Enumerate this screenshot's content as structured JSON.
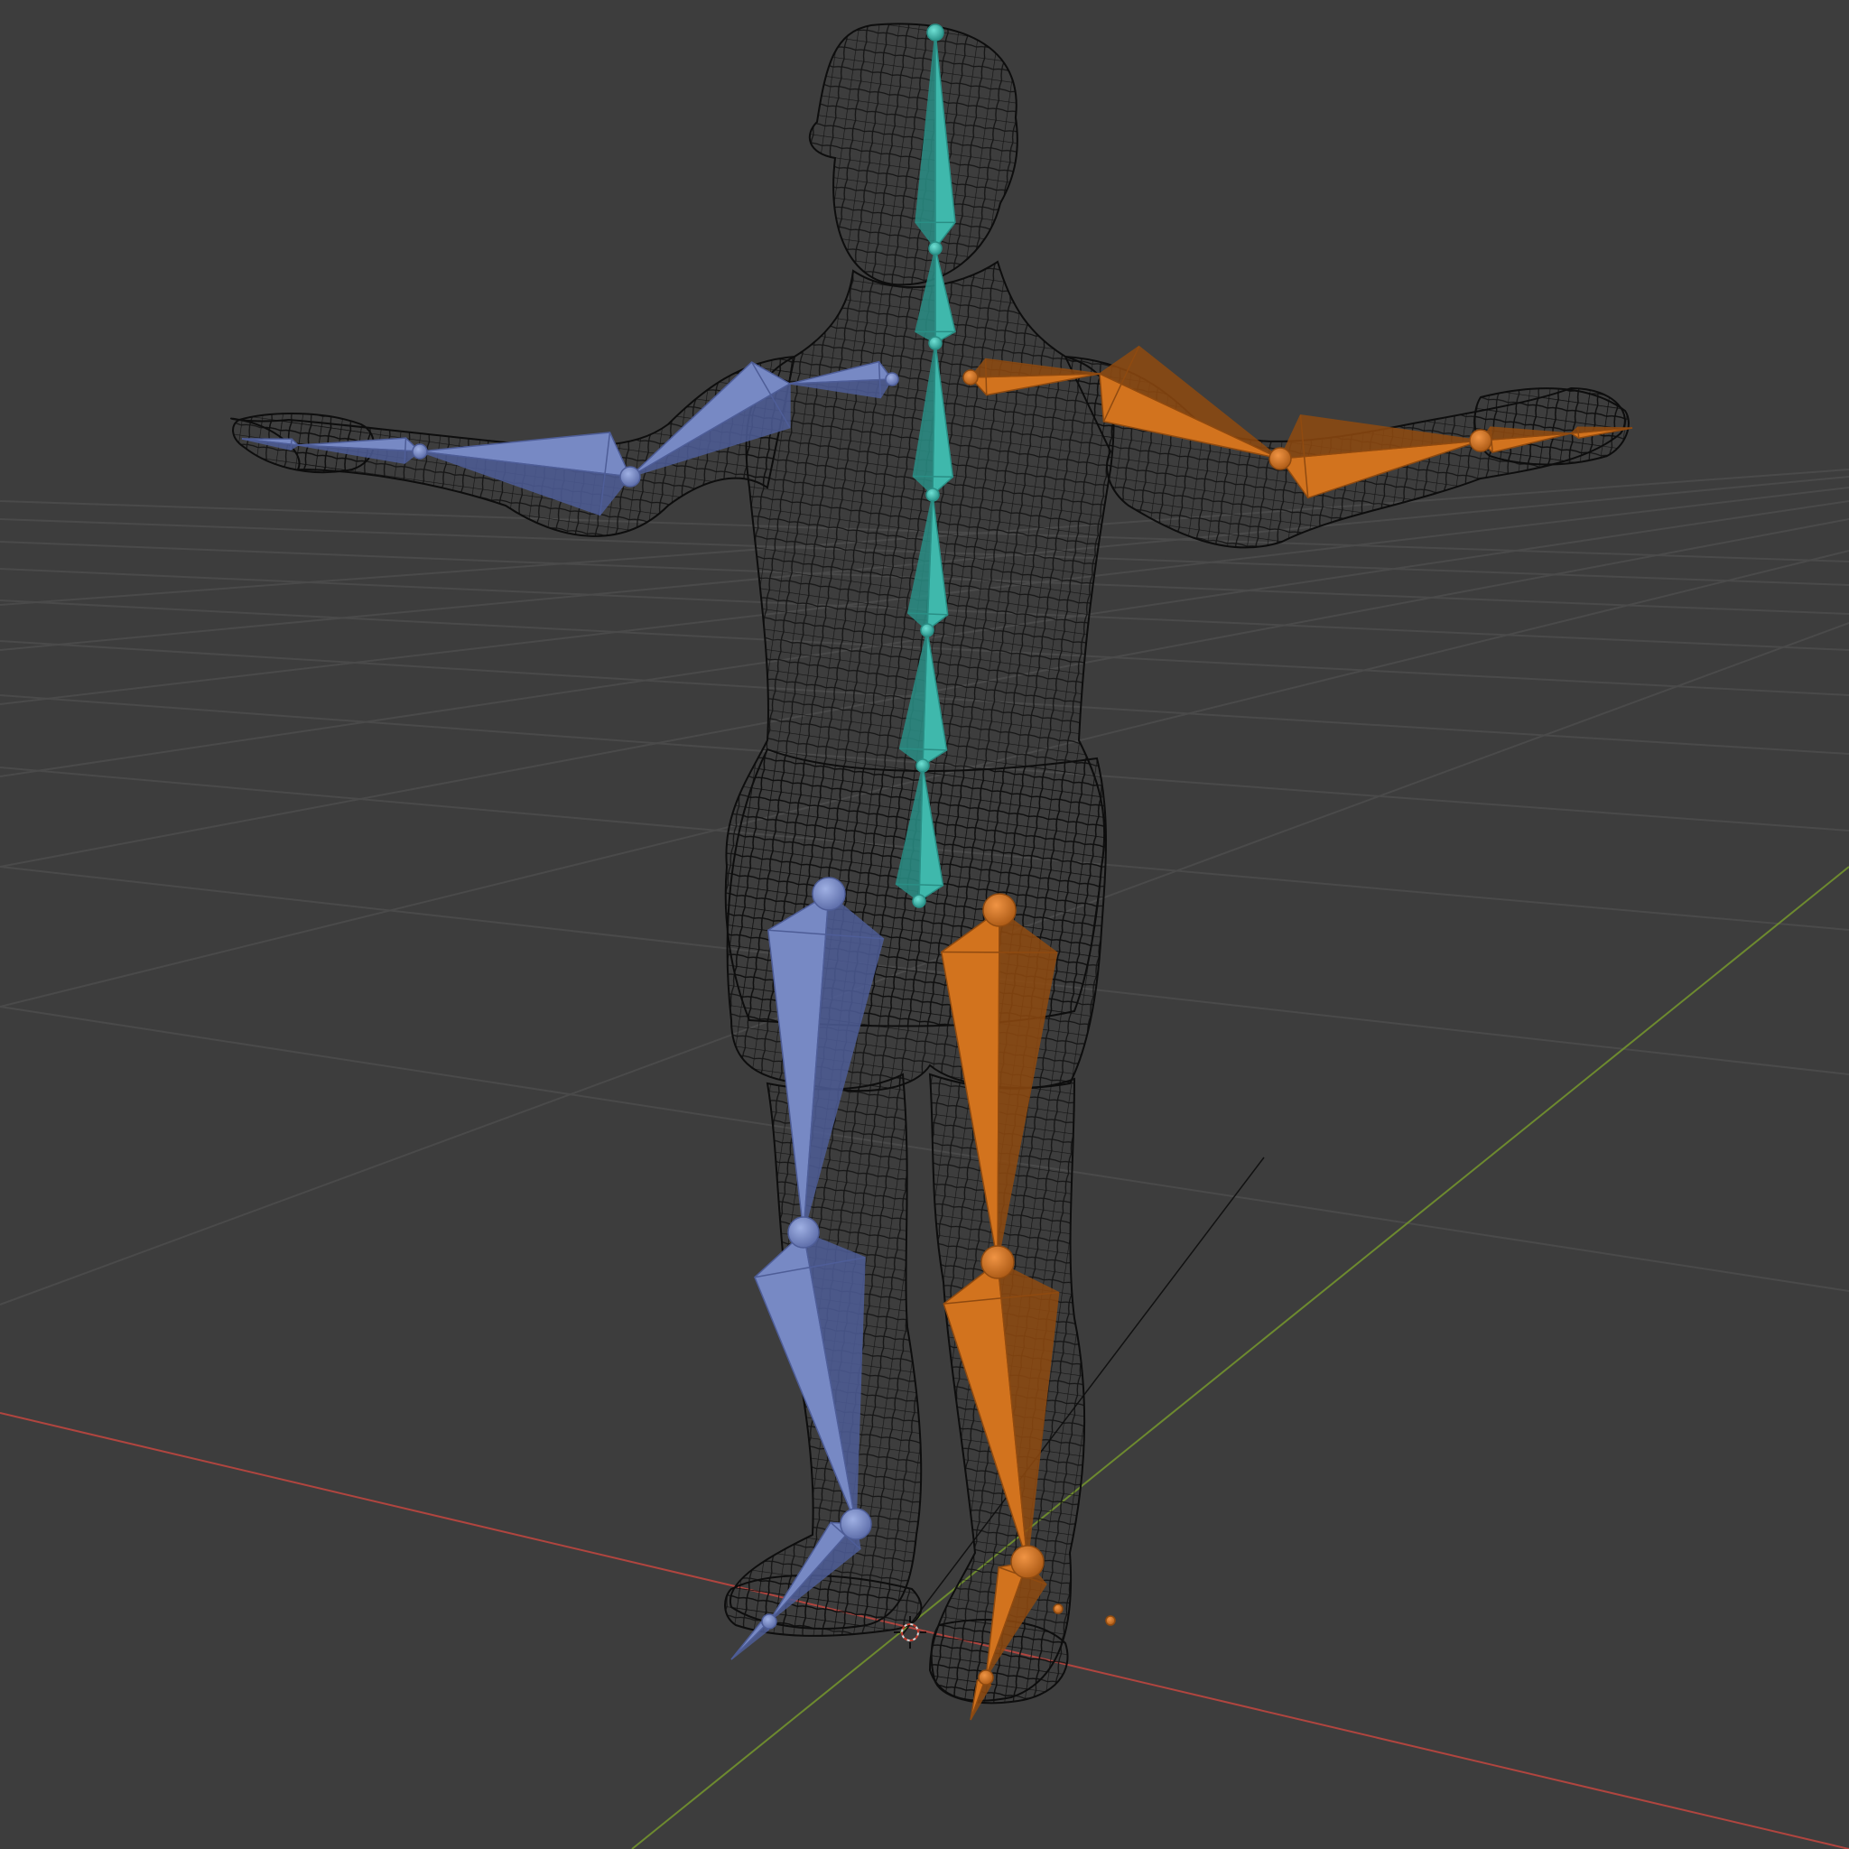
{
  "viewport": {
    "view": "3D Viewport",
    "shading": "wireframe",
    "grid": true,
    "overlays": [
      "floor-grid",
      "x-axis",
      "y-axis",
      "3d-cursor"
    ]
  },
  "colors": {
    "background": "#3d3d3d",
    "grid_line": "#4a4a4a",
    "x_axis": "#b0453f",
    "y_axis": "#6d8a2f",
    "mesh_wire": "#0d0d0d",
    "bone_center": "#3fb8ac",
    "bone_left": "#7789c4",
    "bone_right": "#d2731e"
  },
  "scene": {
    "objects": [
      {
        "name_icon": "mesh-wireframe",
        "type": "mesh",
        "display": "wire"
      },
      {
        "name_icon": "armature",
        "type": "armature",
        "display": "octahedral"
      }
    ],
    "bone_groups": [
      "center",
      "left",
      "right"
    ]
  }
}
